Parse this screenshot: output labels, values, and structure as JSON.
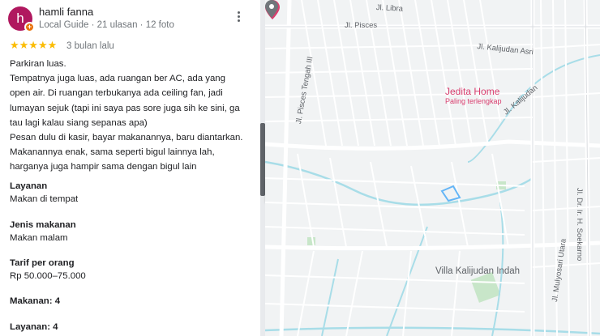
{
  "review": {
    "avatar_letter": "h",
    "badge_glyph": "+",
    "reviewer_name": "hamli fanna",
    "reviewer_meta": "Local Guide · 21 ulasan · 12 foto",
    "rating": 5,
    "rating_display": "★★★★★",
    "date": "3 bulan lalu",
    "text_lines": [
      "Parkiran luas.",
      "Tempatnya juga luas, ada ruangan ber AC, ada yang",
      "open air. Di ruangan terbukanya ada ceiling fan, jadi",
      "lumayan sejuk (tapi ini saya pas sore juga sih ke sini, ga",
      "tau lagi kalau siang sepanas apa)",
      "Pesan dulu di kasir, bayar makanannya, baru diantarkan.",
      "Makanannya enak, sama seperti bigul lainnya lah,",
      "harganya juga hampir sama dengan bigul lain"
    ],
    "attributes": {
      "service_label": "Layanan",
      "service_value": "Makan di tempat",
      "meal_type_label": "Jenis makanan",
      "meal_type_value": "Makan malam",
      "price_label": "Tarif per orang",
      "price_value": "Rp 50.000–75.000",
      "food_rating": "Makanan: 4",
      "service_rating": "Layanan: 4"
    }
  },
  "map": {
    "street_labels": {
      "libra": "Jl. Libra",
      "pisces": "Jl. Pisces",
      "kalijudan_asri": "Jl. Kalijudan Asri",
      "pisces_tengah": "Jl. Pisces Tengah III",
      "kalijudan": "Jl. Kalijudan",
      "soekarno": "Jl. Dr. Ir. H. Soekarno",
      "mulyosari": "Jl. Mulyosari Utara"
    },
    "poi_name": "Jedita Home",
    "poi_subtitle": "Paling terlengkap",
    "area_label": "Villa Kalijudan Indah"
  },
  "colors": {
    "star": "#fbbc04",
    "avatar_bg": "#b0185f",
    "badge_bg": "#e8710a",
    "poi": "#d93f6f",
    "river": "#a8dde8",
    "park": "#c8e6c9"
  },
  "icons": [
    "more-vert-icon",
    "star-icon",
    "chevron-left-icon",
    "hotel-pin-icon",
    "place-pin-icon"
  ]
}
